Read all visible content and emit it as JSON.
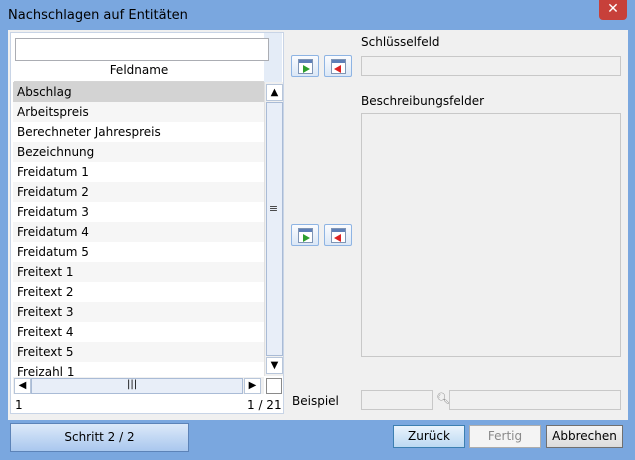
{
  "window": {
    "title": "Nachschlagen auf Entitäten",
    "close_glyph": "✕"
  },
  "list": {
    "filter_value": "",
    "column_header": "Feldname",
    "rows": [
      "Abschlag",
      "Arbeitspreis",
      "Berechneter Jahrespreis",
      "Bezeichnung",
      "Freidatum 1",
      "Freidatum 2",
      "Freidatum 3",
      "Freidatum 4",
      "Freidatum 5",
      "Freitext 1",
      "Freitext 2",
      "Freitext 3",
      "Freitext 4",
      "Freitext 5",
      "Freizahl 1"
    ],
    "selected_index": 0,
    "record_position": "1",
    "record_count": "1 / 21"
  },
  "right": {
    "key_label": "Schlüsselfeld",
    "description_label": "Beschreibungsfelder",
    "example_label": "Beispiel"
  },
  "footer": {
    "step_label": "Schritt 2 / 2",
    "back_label": "Zurück",
    "finish_label": "Fertig",
    "cancel_label": "Abbrechen"
  },
  "icons": {
    "add_right": "document-arrow-right-icon",
    "remove_left": "document-arrow-left-icon",
    "lookup": "magnifier-icon"
  },
  "colors": {
    "window_frame": "#7aa7df",
    "close_button": "#c7403a",
    "selected_row": "#d3d3d3"
  }
}
